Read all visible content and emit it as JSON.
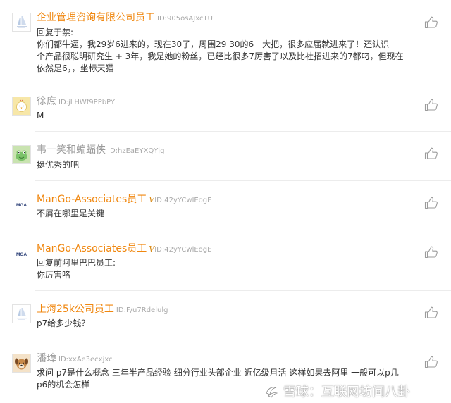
{
  "comments": [
    {
      "name": "企业管理咨询有限公司员工",
      "id": "ID:905osAJxcTU",
      "lines": [
        "回复于禁:",
        "你们都牛逼，我29岁6进来的，现在30了，周围29 30的6一大把，很多应届就进来了！还认识一",
        "个产品很聪明研究生 + 3年，我是她的粉丝，已经比很多7厉害了以及比社招进来的7都叼，但现在",
        "依然是6，，坐标天猫"
      ]
    },
    {
      "name": "徐庶",
      "id": "ID:jLHWf9PPbPY",
      "lines": [
        "M"
      ]
    },
    {
      "name": "韦一笑和蝙蝠侠",
      "id": "ID:hzEaEYXQYjg",
      "lines": [
        "挺优秀的吧"
      ]
    },
    {
      "name": "ManGo-Associates员工",
      "badge": "V",
      "id": "ID:42yYCwlEogE",
      "avatar_text": "MGA",
      "lines": [
        "不屑在哪里是关键"
      ]
    },
    {
      "name": "ManGo-Associates员工",
      "badge": "V",
      "id": "ID:42yYCwlEogE",
      "avatar_text": "MGA",
      "lines": [
        "回复前阿里巴巴员工:",
        "你厉害咯"
      ]
    },
    {
      "name": "上海25k公司员工",
      "id": "ID:F/u7Rdelulg",
      "lines": [
        "p7给多少钱？"
      ]
    },
    {
      "name": "潘璋",
      "id": "ID:xxAe3ecxjxc",
      "lines": [
        "求问 p7是什么概念 三年半产品经验 细分行业头部企业 近亿级月活 这样如果去阿里 一般可以p几",
        "p6的机会怎样"
      ]
    }
  ],
  "watermark": {
    "text": "雪球：互联网坊间八卦",
    "icon": "snowball-logo-icon"
  },
  "colors": {
    "name_orange": "#f0870f",
    "name_gray": "#9a9a9a",
    "id_gray": "#a9a9a9",
    "body_text": "#333333",
    "divider": "#ececec"
  }
}
